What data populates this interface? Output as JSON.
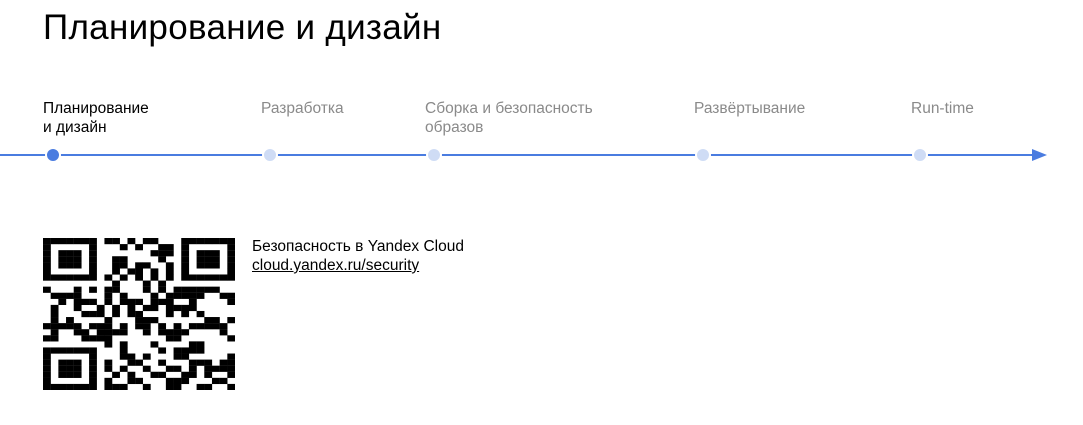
{
  "title": "Планирование и дизайн",
  "stages": [
    {
      "line1": "Планирование",
      "line2": "и дизайн",
      "active": true
    },
    {
      "line1": "Разработка",
      "line2": "",
      "active": false
    },
    {
      "line1": "Сборка и безопасность",
      "line2": "образов",
      "active": false
    },
    {
      "line1": "Развёртывание",
      "line2": "",
      "active": false
    },
    {
      "line1": "Run-time",
      "line2": "",
      "active": false
    }
  ],
  "resource": {
    "title": "Безопасность в Yandex Cloud",
    "link": "cloud.yandex.ru/security"
  },
  "colors": {
    "timeline_line": "#4a7ce0",
    "dot_active": "#4a7ce0",
    "dot_inactive": "#cfdcf5",
    "label_inactive": "#8a8a8a"
  },
  "icons": {
    "qr": "qr-code-icon",
    "arrow": "arrow-right-icon"
  }
}
